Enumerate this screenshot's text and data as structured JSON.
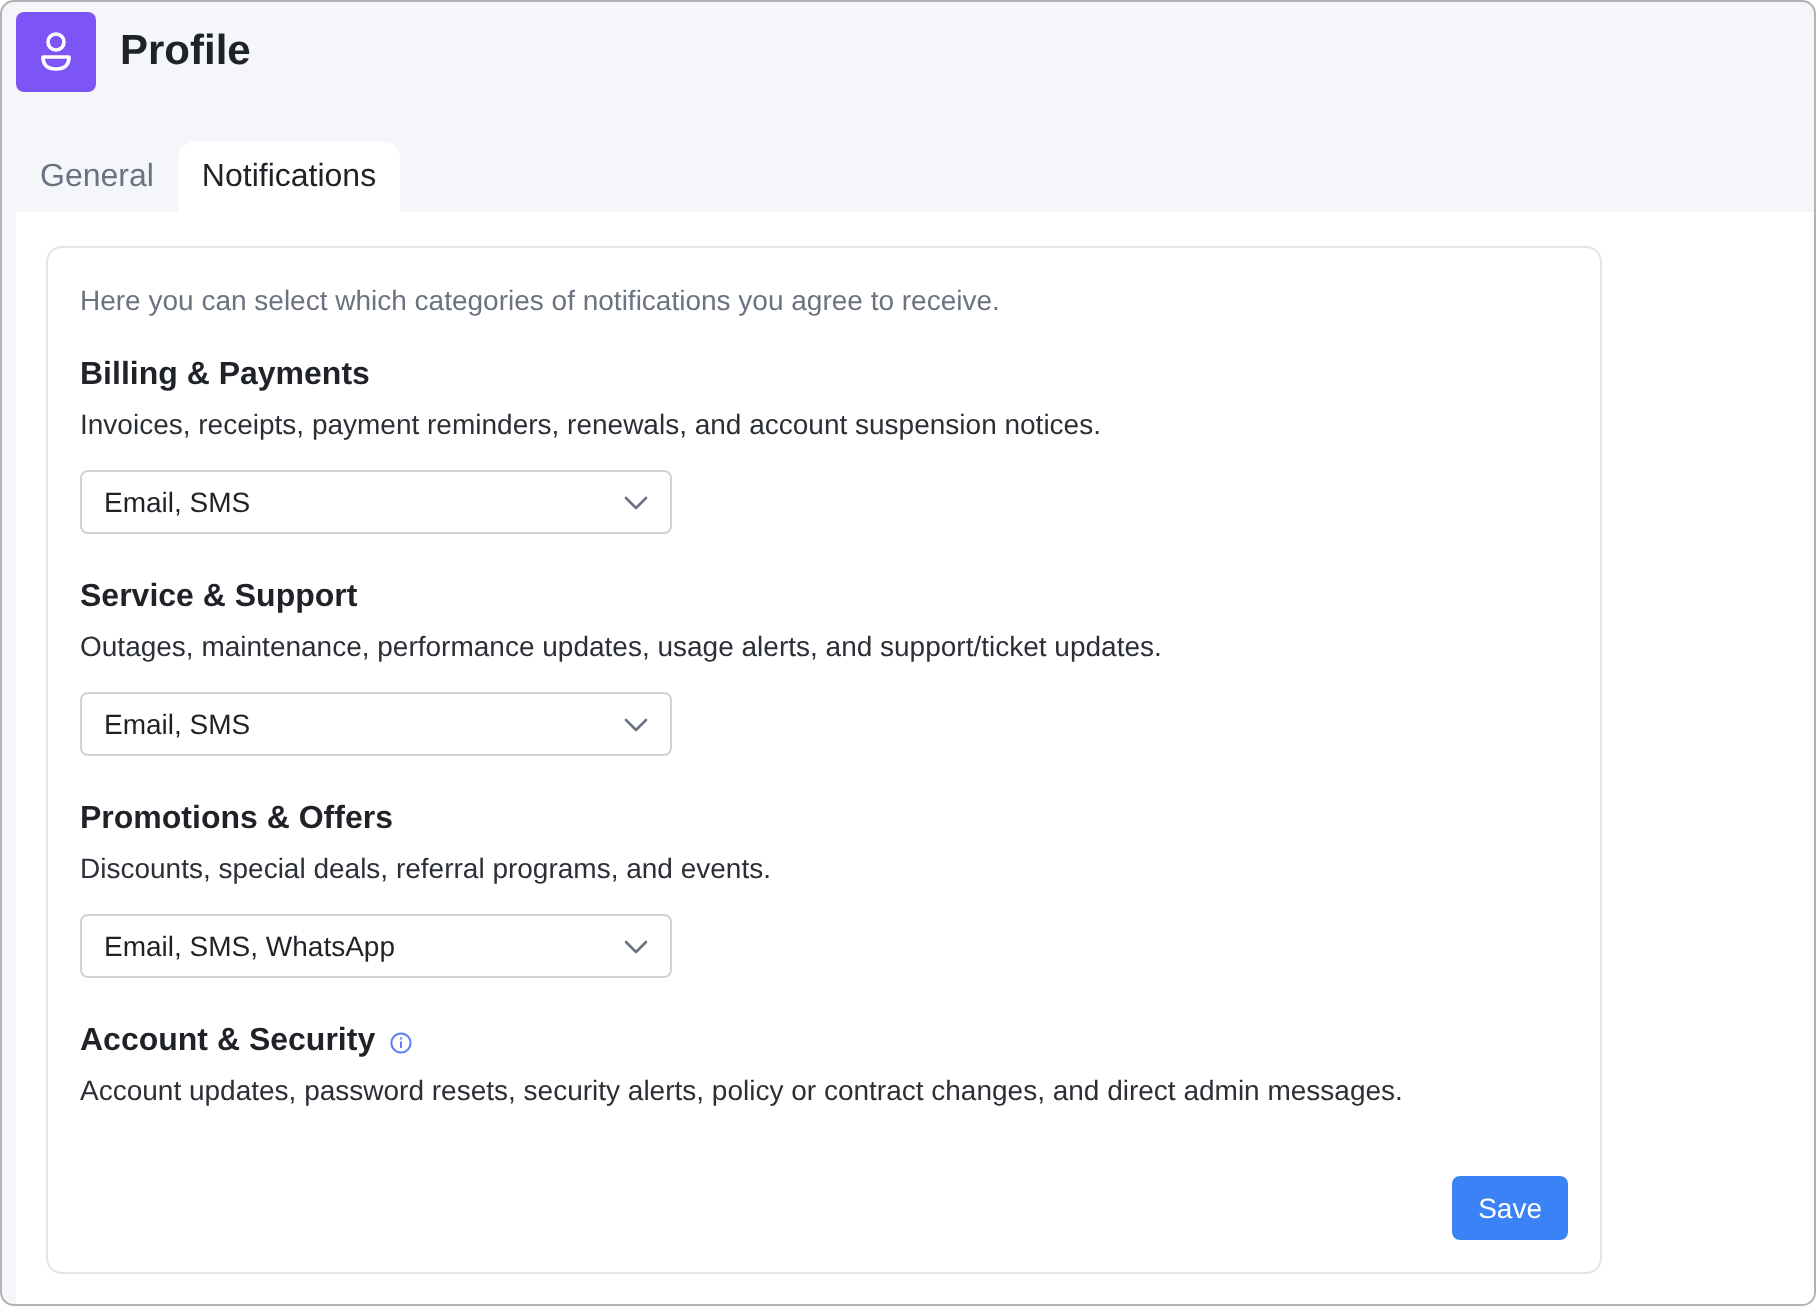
{
  "window": {
    "title": "Profile"
  },
  "tabs": [
    {
      "label": "General",
      "selected": false
    },
    {
      "label": "Notifications",
      "selected": true
    }
  ],
  "intro": "Here you can select which categories of notifications you agree to receive.",
  "categories": [
    {
      "title": "Billing & Payments",
      "info_icon": false,
      "description": "Invoices, receipts, payment reminders, renewals, and account suspension notices.",
      "channels": "Email, SMS"
    },
    {
      "title": "Service & Support",
      "info_icon": false,
      "description": "Outages, maintenance, performance updates, usage alerts, and support/ticket updates.",
      "channels": "Email, SMS"
    },
    {
      "title": "Promotions & Offers",
      "info_icon": false,
      "description": "Discounts, special deals, referral programs, and events.",
      "channels": "Email, SMS, WhatsApp"
    },
    {
      "title": "Account & Security",
      "info_icon": true,
      "description": "Account updates, password resets, security alerts, policy or contract changes, and direct admin messages."
    }
  ],
  "save_button": {
    "label": "Save"
  }
}
